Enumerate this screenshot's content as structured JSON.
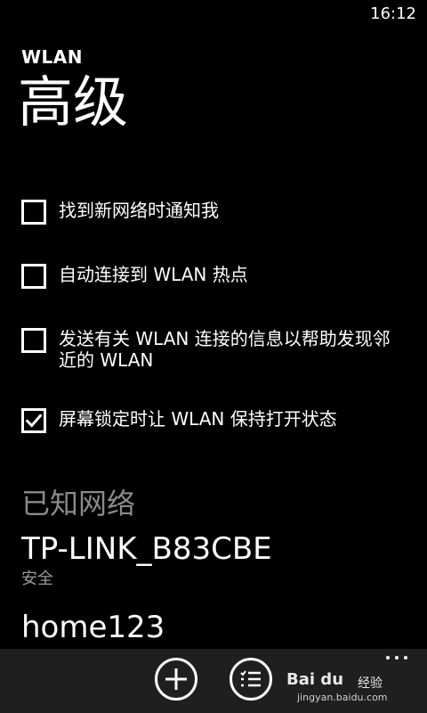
{
  "status_bar": {
    "time": "16:12"
  },
  "header": {
    "app_title": "WLAN",
    "page_title": "高级"
  },
  "options": [
    {
      "label": "找到新网络时通知我",
      "checked": false
    },
    {
      "label": "自动连接到 WLAN 热点",
      "checked": false
    },
    {
      "label": "发送有关 WLAN 连接的信息以帮助发现邻近的 WLAN",
      "checked": false
    },
    {
      "label": "屏幕锁定时让 WLAN 保持打开状态",
      "checked": true
    }
  ],
  "known_networks": {
    "title": "已知网络",
    "items": [
      {
        "name": "TP-LINK_B83CBE",
        "status": "安全"
      },
      {
        "name": "home123",
        "status": ""
      }
    ]
  },
  "app_bar": {
    "buttons": [
      {
        "icon": "add-icon"
      },
      {
        "icon": "list-icon"
      }
    ],
    "more_icon": "more-dots-icon"
  },
  "watermark": {
    "logo": "Bai du",
    "text": "经验",
    "url": "jingyan.baidu.com"
  }
}
